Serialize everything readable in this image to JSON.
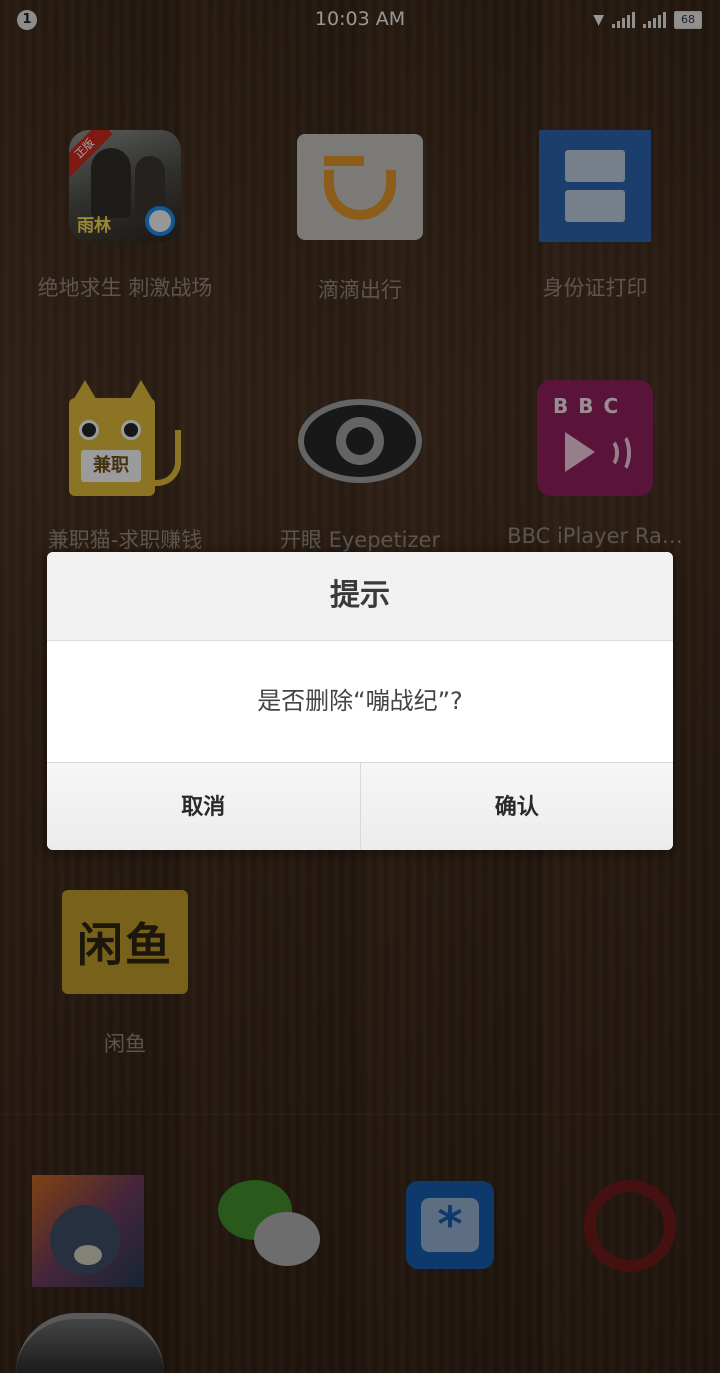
{
  "status_bar": {
    "notification_count": "1",
    "time": "10:03 AM",
    "battery": "68"
  },
  "apps": [
    {
      "label": "绝地求生 刺激战场",
      "icon": "pubg-icon"
    },
    {
      "label": "滴滴出行",
      "icon": "didi-icon"
    },
    {
      "label": "身份证打印",
      "icon": "id-card-icon"
    },
    {
      "label": "兼职猫-求职赚钱",
      "icon": "jianzhimao-icon",
      "icon_text": "兼职"
    },
    {
      "label": "开眼 Eyepetizer",
      "icon": "eye-icon"
    },
    {
      "label": "BBC iPlayer Ra…",
      "icon": "bbc-iplayer-icon",
      "icon_text": "BBC"
    },
    {
      "label": "闲鱼",
      "icon": "xianyu-icon",
      "icon_text": "闲鱼"
    }
  ],
  "pubg_icon_text": "雨林",
  "pubg_ribbon": "正版",
  "dock": [
    {
      "icon": "tom-cat-game-icon"
    },
    {
      "icon": "wechat-icon"
    },
    {
      "icon": "tim-icon"
    },
    {
      "icon": "quora-icon"
    }
  ],
  "dialog": {
    "title": "提示",
    "message": "是否删除“嘣战纪”?",
    "cancel": "取消",
    "confirm": "确认"
  }
}
